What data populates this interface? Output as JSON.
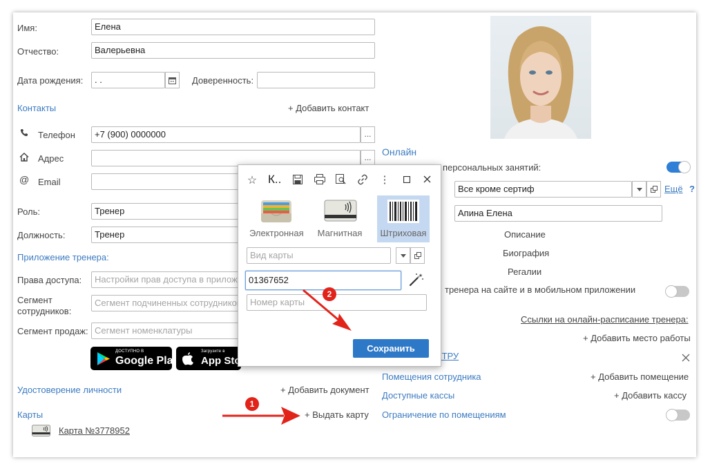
{
  "form": {
    "name_label": "Имя:",
    "name_value": "Елена",
    "patronymic_label": "Отчество:",
    "patronymic_value": "Валерьевна",
    "birth_label": "Дата рождения:",
    "birth_value": " .  .",
    "proxy_label": "Доверенность:",
    "contacts_link": "Контакты",
    "add_contact": "+ Добавить контакт",
    "phone_label": "Телефон",
    "phone_value": "+7 (900) 0000000",
    "address_label": "Адрес",
    "email_label": "Email",
    "role_label": "Роль:",
    "role_value": "Тренер",
    "position_label": "Должность:",
    "position_value": "Тренер",
    "trainer_app_link": "Приложение тренера:",
    "access_label": "Права доступа:",
    "access_placeholder": "Настройки прав доступа в приложении",
    "segment_emp_label": "Сегмент сотрудников:",
    "segment_emp_placeholder": "Сегмент подчиненных сотрудников",
    "segment_sales_label": "Сегмент продаж:",
    "segment_sales_placeholder": "Сегмент номенклатуры",
    "google_small": "ДОСТУПНО В",
    "google_big": "Google Play",
    "apple_small": "Загрузите в",
    "apple_big": "App Store",
    "identity_link": "Удостоверение личности",
    "add_document": "+ Добавить документ",
    "cards_link": "Карты",
    "issue_card": "+ Выдать карту",
    "card_link": "Карта №3778952",
    "ellipsis": "..."
  },
  "right": {
    "online_title": "Онлайн",
    "personal_label": "персональных занятий:",
    "filter_value": "Все кроме сертиф",
    "more_link": "Ещё",
    "help": "?",
    "name_value": "Апина Елена",
    "desc_label": "Описание",
    "bio_label": "Биография",
    "regalia_label": "Регалии",
    "show_site_label": "тренера на сайте и в мобильном приложении",
    "schedule_link": "Ссылки на онлайн-расписание тренера:",
    "add_workplace": "+ Добавить место работы",
    "tru_link": "нь ТРУ",
    "rooms_link": "Помещения сотрудника",
    "add_room": "+ Добавить помещение",
    "cashdesk_link": "Доступные кассы",
    "add_cashdesk": "+ Добавить кассу",
    "restrict_link": "Ограничение по помещениям"
  },
  "dialog": {
    "title": "К..",
    "type_electronic": "Электронная",
    "type_magnetic": "Магнитная",
    "type_barcode": "Штриховая",
    "card_kind_placeholder": "Вид карты",
    "barcode_value": "01367652",
    "card_number_placeholder": "Номер карты",
    "save_label": "Сохранить"
  },
  "annotations": {
    "step1": "1",
    "step2": "2"
  },
  "colors": {
    "accent": "#2e78c8",
    "link": "#3c7bc1",
    "arrow": "#e2231a",
    "selected_bg": "#c5d8f1"
  }
}
